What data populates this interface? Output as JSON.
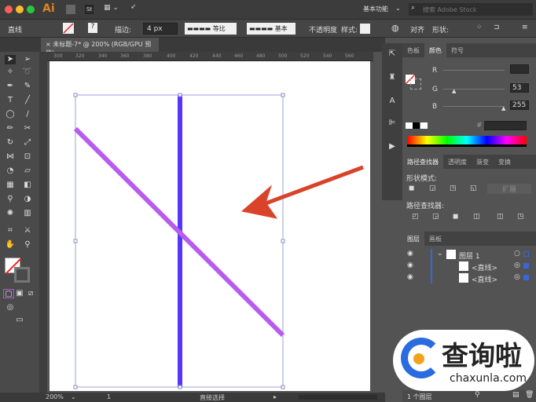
{
  "app": {
    "logo": "Ai",
    "st_label": "St",
    "workspace": "基本功能",
    "search_placeholder": "搜索 Adobe Stock"
  },
  "control_bar": {
    "object_type": "直线",
    "stroke_label": "描边:",
    "stroke_value": "4 px",
    "profile_label": "等比",
    "brush_label": "基本",
    "opacity_label": "不透明度",
    "style_label": "样式:",
    "align_label": "对齐",
    "shape_label": "形状:"
  },
  "document_tab": {
    "close": "×",
    "title": "未标题-7* @ 200% (RGB/GPU 预览)"
  },
  "ruler_ticks": [
    "300",
    "320",
    "340",
    "360",
    "380",
    "400",
    "420",
    "440",
    "460",
    "480",
    "500",
    "520",
    "540",
    "560"
  ],
  "color_panel": {
    "tabs": [
      "色板",
      "颜色",
      "符号"
    ],
    "active_tab": "颜色",
    "channels": [
      {
        "label": "R",
        "value": ""
      },
      {
        "label": "G",
        "value": "53"
      },
      {
        "label": "B",
        "value": "255"
      }
    ],
    "hex_label": "#",
    "hex_value": ""
  },
  "pathfinder_panel": {
    "tabs": [
      "路径查找器",
      "透明度",
      "渐变",
      "变换"
    ],
    "shape_modes_label": "形状模式:",
    "expand_label": "扩展",
    "pathfinders_label": "路径查找器:"
  },
  "layers_panel": {
    "tabs": [
      "图层",
      "画板"
    ],
    "layers": [
      {
        "name": "图层 1",
        "level": 0
      },
      {
        "name": "<直线>",
        "level": 1
      },
      {
        "name": "<直线>",
        "level": 1
      }
    ],
    "footer": "1 个图层"
  },
  "status_bar": {
    "zoom": "200%",
    "artboard": "1",
    "tool": "直接选择"
  },
  "watermark": {
    "text": "查询啦",
    "url": "chaxunla.com"
  },
  "colors": {
    "vertical_line": "#5535ff",
    "diagonal_line": "#b85cf0",
    "arrow": "#d9432a",
    "accent": "#2b6be0"
  }
}
